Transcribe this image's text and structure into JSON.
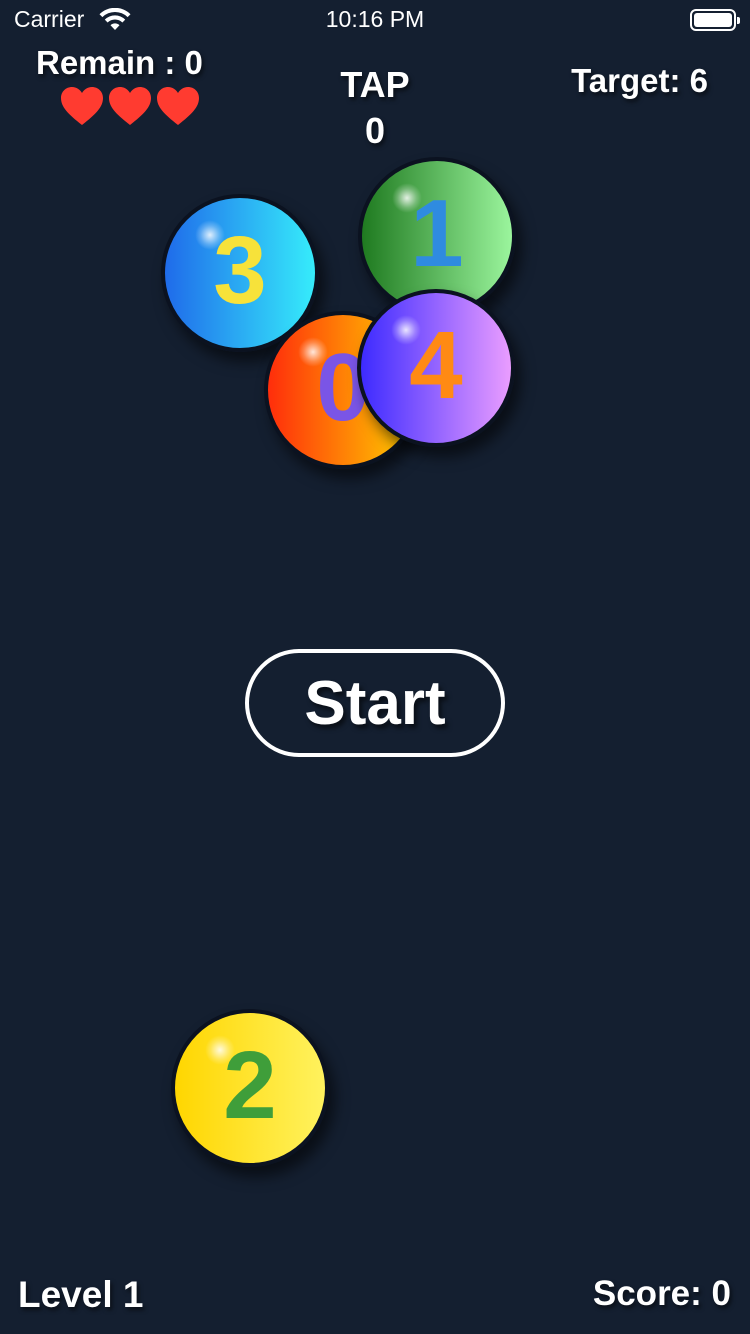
{
  "status_bar": {
    "carrier": "Carrier",
    "time": "10:16 PM"
  },
  "hud": {
    "remain": "Remain : 0",
    "lives": 3,
    "tap_label": "TAP",
    "tap_count": "0",
    "target": "Target: 6"
  },
  "balls": [
    {
      "number": "3",
      "bg_from": "#1f6bea",
      "bg_to": "#36ecfb",
      "text_color": "#f7e23a"
    },
    {
      "number": "1",
      "bg_from": "#1f7a20",
      "bg_to": "#9bf59d",
      "text_color": "#2f8be0"
    },
    {
      "number": "0",
      "bg_from": "#ff2d0b",
      "bg_to": "#ffd400",
      "text_color": "#7a55e6"
    },
    {
      "number": "4",
      "bg_from": "#3d2bff",
      "bg_to": "#ea9dff",
      "text_color": "#ff8a14"
    },
    {
      "number": "2",
      "bg_from": "#ffd600",
      "bg_to": "#fff25e",
      "text_color": "#3f9e3a"
    }
  ],
  "start_button": "Start",
  "footer": {
    "level": "Level 1",
    "score": "Score: 0"
  },
  "colors": {
    "background": "#141f30",
    "heart": "#ff3b30",
    "text": "#ffffff"
  }
}
